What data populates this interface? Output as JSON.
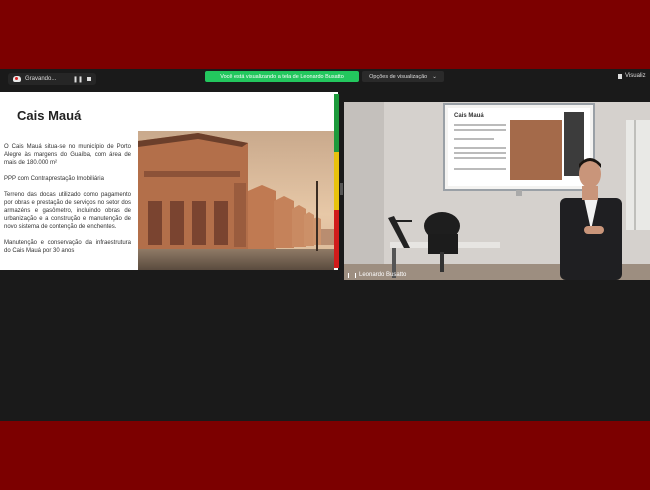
{
  "recording": {
    "label": "Gravando...",
    "pause_icon": "pause-icon",
    "stop_icon": "stop-icon"
  },
  "share_banner": "Você está visualizando a tela de Leonardo Busatto",
  "view_options": {
    "label": "Opções de visualização",
    "chevron": "⌄"
  },
  "view_right": "Visualiz",
  "slide": {
    "title": "Cais Mauá",
    "paragraphs": [
      "O Cais Mauá situa-se no município de Porto Alegre às margens do Guaíba, com área de mais de 180.000 m²",
      "PPP com Contraprestação Imobiliária",
      "Terreno das docas utilizado como pagamento por obras e prestação de serviços no setor dos armazéns e gasômetro, incluindo obras de urbanização e a construção e manutenção de novo sistema de contenção de enchentes.",
      "Manutenção e conservação da infraestrutura do Cais Mauá por 30 anos"
    ],
    "bar_colors": [
      "#1d9a3c",
      "#e8c20c",
      "#d11b1b"
    ]
  },
  "video": {
    "participant": "Leonardo Busatto",
    "projected_slide_title": "Cais Mauá"
  },
  "colors": {
    "background": "#7c0000",
    "app": "#1a1a1a",
    "banner": "#23c75e"
  }
}
